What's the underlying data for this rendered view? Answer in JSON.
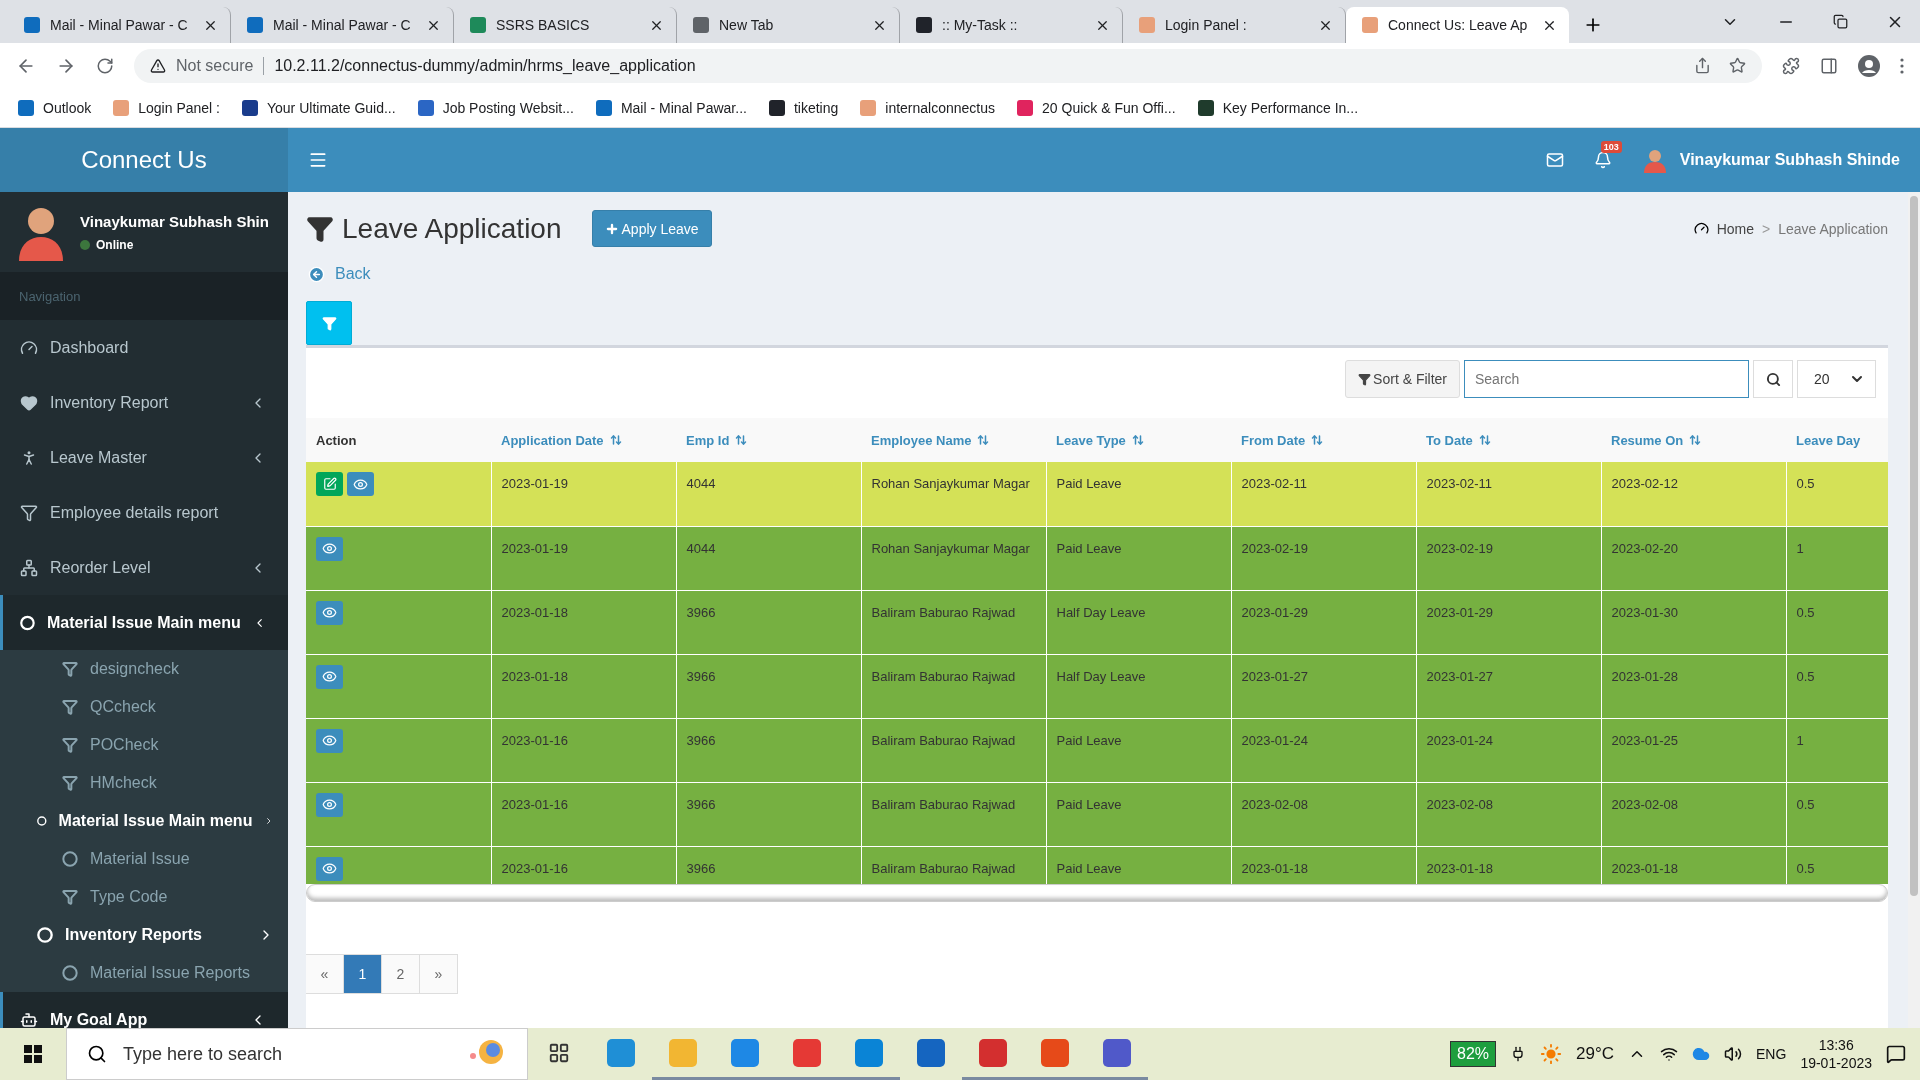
{
  "browser": {
    "tabs": [
      {
        "title": "Mail - Minal Pawar - C",
        "color": "#0f6cbd",
        "selected": false
      },
      {
        "title": "Mail - Minal Pawar - C",
        "color": "#0f6cbd",
        "selected": false
      },
      {
        "title": "SSRS BASICS",
        "color": "#1e8a5a",
        "selected": false
      },
      {
        "title": "New Tab",
        "color": "#5f6368",
        "selected": false
      },
      {
        "title": ":: My-Task ::",
        "color": "#20232a",
        "selected": false
      },
      {
        "title": "Login Panel :",
        "color": "#e8a07a",
        "selected": false
      },
      {
        "title": "Connect Us: Leave Ap",
        "color": "#e8a07a",
        "selected": true
      }
    ],
    "address": {
      "security": "Not secure",
      "url": "10.2.11.2/connectus-dummy/admin/hrms_leave_application"
    },
    "bookmarks": [
      {
        "label": "Outlook",
        "color": "#0f6cbd"
      },
      {
        "label": "Login Panel :",
        "color": "#e8a07a"
      },
      {
        "label": "Your Ultimate Guid...",
        "color": "#1a3c8c"
      },
      {
        "label": "Job Posting Websit...",
        "color": "#2b66c4"
      },
      {
        "label": "Mail - Minal Pawar...",
        "color": "#0f6cbd"
      },
      {
        "label": "tiketing",
        "color": "#20232a"
      },
      {
        "label": "internalconnectus",
        "color": "#e8a07a"
      },
      {
        "label": "20 Quick & Fun Offi...",
        "color": "#e0245e"
      },
      {
        "label": "Key Performance In...",
        "color": "#1f3b2c"
      }
    ]
  },
  "app": {
    "brand": "Connect Us",
    "user": {
      "name": "Vinaykumar Subhash Shin",
      "status": "Online"
    },
    "nav_header": "Navigation",
    "menu": [
      {
        "label": "Dashboard",
        "submenu": false,
        "selected": false
      },
      {
        "label": "Inventory Report",
        "submenu": true,
        "selected": false
      },
      {
        "label": "Leave Master",
        "submenu": true,
        "selected": false
      },
      {
        "label": "Employee details report",
        "submenu": false,
        "selected": false
      },
      {
        "label": "Reorder Level",
        "submenu": true,
        "selected": false
      },
      {
        "label": "Material Issue Main menu",
        "submenu": true,
        "selected": true,
        "children": [
          {
            "label": "designcheck",
            "kind": "report"
          },
          {
            "label": "QCcheck",
            "kind": "report"
          },
          {
            "label": "POCheck",
            "kind": "report"
          },
          {
            "label": "HMcheck",
            "kind": "report"
          },
          {
            "label": "Material Issue Main menu",
            "kind": "group",
            "children": [
              {
                "label": "Material Issue",
                "kind": "page"
              },
              {
                "label": "Type Code",
                "kind": "report"
              }
            ]
          },
          {
            "label": "Inventory Reports",
            "kind": "group",
            "children": [
              {
                "label": "Material Issue Reports",
                "kind": "page"
              }
            ]
          }
        ]
      },
      {
        "label": "My Goal App",
        "submenu": true,
        "selected": true
      }
    ],
    "header": {
      "notifications": "103",
      "user_name": "Vinaykumar Subhash Shinde"
    }
  },
  "page": {
    "title": "Leave Application",
    "apply_button": "Apply Leave",
    "breadcrumb": [
      "Home",
      "Leave Application"
    ],
    "breadcrumb_separator": ">",
    "back": "Back",
    "toolbar": {
      "sort_filter": "Sort & Filter",
      "search_placeholder": "Search",
      "page_size": "20"
    },
    "table": {
      "action_header": "Action",
      "columns": [
        "Application Date",
        "Emp Id",
        "Employee Name",
        "Leave Type",
        "From Date",
        "To Date",
        "Resume On",
        "Leave Day"
      ],
      "rows": [
        {
          "highlighted": true,
          "editable": true,
          "cells": [
            "2023-01-19",
            "4044",
            "Rohan Sanjaykumar Magar",
            "Paid Leave",
            "2023-02-11",
            "2023-02-11",
            "2023-02-12",
            "0.5"
          ]
        },
        {
          "highlighted": false,
          "editable": false,
          "cells": [
            "2023-01-19",
            "4044",
            "Rohan Sanjaykumar Magar",
            "Paid Leave",
            "2023-02-19",
            "2023-02-19",
            "2023-02-20",
            "1"
          ]
        },
        {
          "highlighted": false,
          "editable": false,
          "cells": [
            "2023-01-18",
            "3966",
            "Baliram Baburao Rajwad",
            "Half Day Leave",
            "2023-01-29",
            "2023-01-29",
            "2023-01-30",
            "0.5"
          ]
        },
        {
          "highlighted": false,
          "editable": false,
          "cells": [
            "2023-01-18",
            "3966",
            "Baliram Baburao Rajwad",
            "Half Day Leave",
            "2023-01-27",
            "2023-01-27",
            "2023-01-28",
            "0.5"
          ]
        },
        {
          "highlighted": false,
          "editable": false,
          "cells": [
            "2023-01-16",
            "3966",
            "Baliram Baburao Rajwad",
            "Paid Leave",
            "2023-01-24",
            "2023-01-24",
            "2023-01-25",
            "1"
          ]
        },
        {
          "highlighted": false,
          "editable": false,
          "cells": [
            "2023-01-16",
            "3966",
            "Baliram Baburao Rajwad",
            "Paid Leave",
            "2023-02-08",
            "2023-02-08",
            "2023-02-08",
            "0.5"
          ]
        },
        {
          "highlighted": false,
          "editable": false,
          "cells": [
            "2023-01-16",
            "3966",
            "Baliram Baburao Rajwad",
            "Paid Leave",
            "2023-01-18",
            "2023-01-18",
            "2023-01-18",
            "0.5"
          ]
        }
      ]
    },
    "pagination": [
      {
        "label": "«",
        "selected": false
      },
      {
        "label": "1",
        "selected": true
      },
      {
        "label": "2",
        "selected": false
      },
      {
        "label": "»",
        "selected": false
      }
    ]
  },
  "taskbar": {
    "search_placeholder": "Type here to search",
    "apps": [
      {
        "running": false
      },
      {
        "color": "#1f8fd6",
        "running": false
      },
      {
        "color": "#f2b632",
        "running": true
      },
      {
        "color": "#1e88e5",
        "running": true
      },
      {
        "color": "#e53935",
        "running": true
      },
      {
        "color": "#0a84d6",
        "running": true
      },
      {
        "color": "#1565c0",
        "running": false
      },
      {
        "color": "#d32f2f",
        "running": true
      },
      {
        "color": "#e64a19",
        "running": true
      },
      {
        "color": "#5059c9",
        "running": true
      }
    ],
    "battery": "82%",
    "weather": "29°C",
    "language": "ENG",
    "time": "13:36",
    "date": "19-01-2023"
  }
}
